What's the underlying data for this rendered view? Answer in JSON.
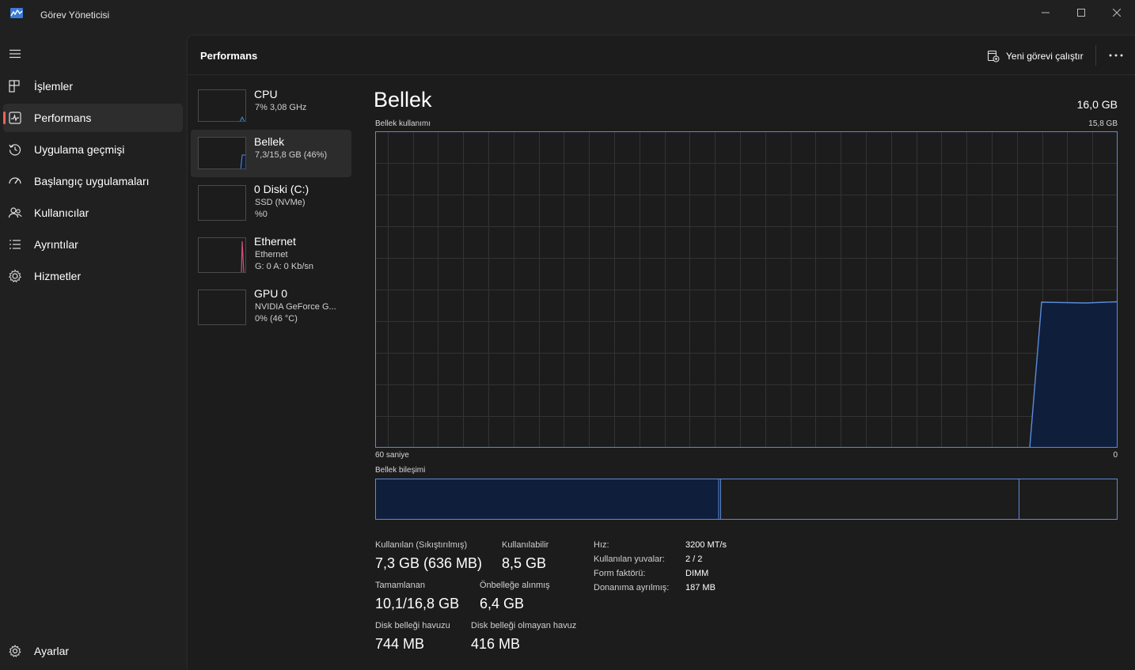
{
  "window": {
    "title": "Görev Yöneticisi"
  },
  "sidebar": {
    "items": [
      {
        "label": "İşlemler",
        "icon": "processes-icon"
      },
      {
        "label": "Performans",
        "icon": "performance-icon"
      },
      {
        "label": "Uygulama geçmişi",
        "icon": "history-icon"
      },
      {
        "label": "Başlangıç uygulamaları",
        "icon": "startup-icon"
      },
      {
        "label": "Kullanıcılar",
        "icon": "users-icon"
      },
      {
        "label": "Ayrıntılar",
        "icon": "details-icon"
      },
      {
        "label": "Hizmetler",
        "icon": "services-icon"
      }
    ],
    "settings_label": "Ayarlar",
    "active_index": 1
  },
  "header": {
    "title": "Performans",
    "run_task_label": "Yeni görevi çalıştır"
  },
  "devices": [
    {
      "name": "CPU",
      "line1": "7% 3,08 GHz",
      "line2": ""
    },
    {
      "name": "Bellek",
      "line1": "7,3/15,8 GB (46%)",
      "line2": ""
    },
    {
      "name": "0 Diski (C:)",
      "line1": "SSD (NVMe)",
      "line2": "%0"
    },
    {
      "name": "Ethernet",
      "line1": "Ethernet",
      "line2": "G: 0 A: 0 Kb/sn"
    },
    {
      "name": "GPU 0",
      "line1": "NVIDIA GeForce G...",
      "line2": "0% (46 °C)"
    }
  ],
  "detail": {
    "title": "Bellek",
    "total": "16,0 GB",
    "usage_label": "Bellek kullanımı",
    "usage_max": "15,8 GB",
    "time_left": "60 saniye",
    "time_right": "0",
    "composition_label": "Bellek bileşimi",
    "usage_fraction": 0.46
  },
  "stats": {
    "in_use_label": "Kullanılan (Sıkıştırılmış)",
    "in_use_value": "7,3 GB (636 MB)",
    "available_label": "Kullanılabilir",
    "available_value": "8,5 GB",
    "committed_label": "Tamamlanan",
    "committed_value": "10,1/16,8 GB",
    "cached_label": "Önbelleğe alınmış",
    "cached_value": "6,4 GB",
    "paged_label": "Disk belleği havuzu",
    "paged_value": "744 MB",
    "nonpaged_label": "Disk belleği olmayan havuz",
    "nonpaged_value": "416 MB"
  },
  "specs": {
    "speed_label": "Hız:",
    "speed_value": "3200 MT/s",
    "slots_label": "Kullanılan yuvalar:",
    "slots_value": "2 / 2",
    "form_label": "Form faktörü:",
    "form_value": "DIMM",
    "reserved_label": "Donanıma ayrılmış:",
    "reserved_value": "187 MB"
  },
  "colors": {
    "memory_line": "#5b8bd9",
    "memory_fill": "#0f1e3a",
    "cpu_line": "#4a8fd0",
    "ethernet_line": "#d4507a",
    "accent_active": "#e8645a"
  }
}
